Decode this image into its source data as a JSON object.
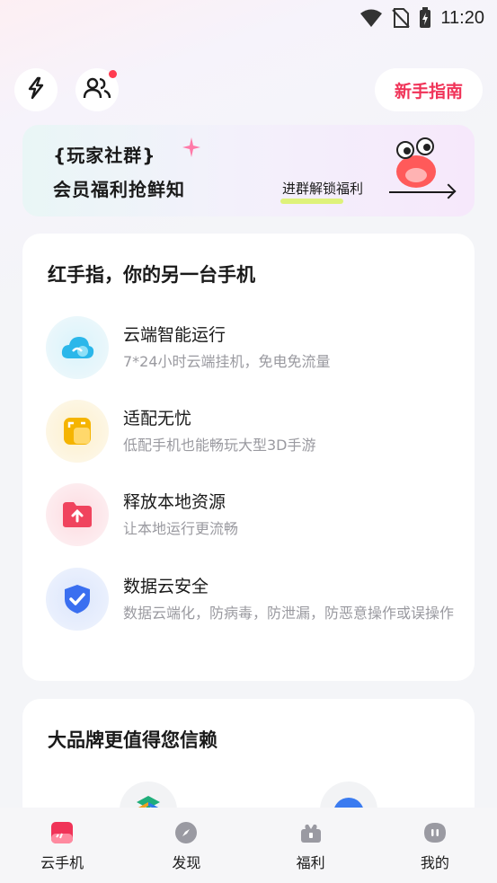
{
  "status_bar": {
    "time": "11:20",
    "icons": [
      "wifi-icon",
      "no-sim-icon",
      "battery-charging-icon"
    ]
  },
  "top_bar": {
    "left_icons": [
      "lightning-icon",
      "community-icon"
    ],
    "guide_label": "新手指南"
  },
  "banner": {
    "line1": "{玩家社群}",
    "line2": "会员福利抢鲜知",
    "cta": "进群解锁福利",
    "colors": {
      "cta_highlight": "#d8f35a"
    }
  },
  "features": {
    "title": "红手指，你的另一台手机",
    "items": [
      {
        "title": "云端智能运行",
        "desc": "7*24小时云端挂机，免电免流量",
        "icon": "cloud-icon",
        "color": "#29b6e8"
      },
      {
        "title": "适配无忧",
        "desc": "低配手机也能畅玩大型3D手游",
        "icon": "adapt-icon",
        "color": "#f5b400"
      },
      {
        "title": "释放本地资源",
        "desc": "让本地运行更流畅",
        "icon": "upload-folder-icon",
        "color": "#f0445e"
      },
      {
        "title": "数据云安全",
        "desc": "数据云端化，防病毒，防泄漏，防恶意操作或误操作",
        "icon": "shield-check-icon",
        "color": "#3a6ff0"
      }
    ]
  },
  "brand": {
    "title": "大品牌更值得您信赖"
  },
  "tab_bar": {
    "tabs": [
      {
        "label": "云手机",
        "icon": "cloud-phone-icon",
        "active": true
      },
      {
        "label": "发现",
        "icon": "compass-icon",
        "active": false
      },
      {
        "label": "福利",
        "icon": "gift-icon",
        "active": false
      },
      {
        "label": "我的",
        "icon": "profile-icon",
        "active": false
      }
    ]
  },
  "colors": {
    "accent": "#f03358",
    "background": "#f4f5f8"
  }
}
